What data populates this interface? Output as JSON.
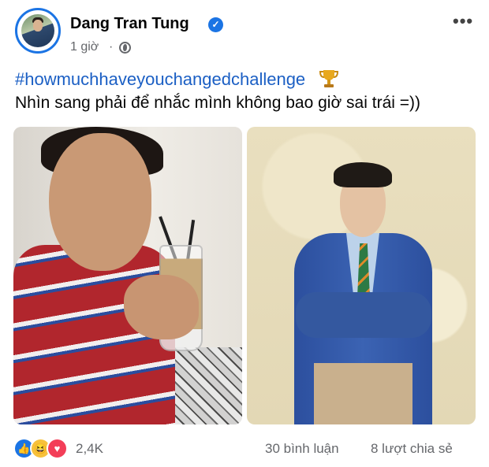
{
  "post": {
    "author": "Dang Tran Tung",
    "verified_icon": "verified-badge-icon",
    "time": "1 giờ",
    "separator": "·",
    "privacy_icon": "globe-icon",
    "more_icon": "•••",
    "hashtag": "#howmuchhaveyouchangedchallenge",
    "trophy_icon": "trophy-icon",
    "caption": "Nhìn sang phải để nhắc mình không bao giờ sai trái =))",
    "photos": [
      "photo-before",
      "photo-after"
    ]
  },
  "footer": {
    "reactions": [
      "like",
      "haha",
      "love"
    ],
    "reaction_count": "2,4K",
    "comments": "30 bình luận",
    "shares": "8 lượt chia sẻ"
  },
  "colors": {
    "accent": "#1b74e4",
    "hashtag": "#1b5fc4",
    "secondary_text": "#65676b"
  }
}
